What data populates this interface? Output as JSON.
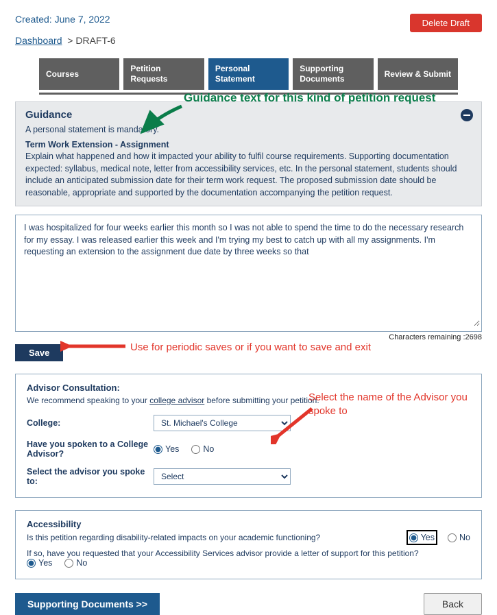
{
  "header": {
    "created_label": "Created: June 7, 2022",
    "delete_button": "Delete Draft"
  },
  "breadcrumb": {
    "link": "Dashboard",
    "current": "DRAFT-6"
  },
  "tabs": [
    {
      "label": "Courses"
    },
    {
      "label": "Petition Requests"
    },
    {
      "label": "Personal Statement",
      "active": true
    },
    {
      "label": "Supporting Documents"
    },
    {
      "label": "Review & Submit"
    }
  ],
  "guidance": {
    "title": "Guidance",
    "mandatory": "A personal statement is mandatory.",
    "subtype": "Term Work Extension - Assignment",
    "body": "Explain what happened and how it impacted your ability to fulfil course requirements. Supporting documentation expected: syllabus, medical note, letter from accessibility services, etc. In the personal statement, students should include an anticipated submission date for their term work request. The proposed submission date should be reasonable, appropriate and supported by the documentation accompanying the petition request."
  },
  "annotations": {
    "guidance_text": "Guidance text for this kind of petition request",
    "save_text": "Use for periodic saves or if you want to save and exit",
    "advisor_text": "Select the name of the Advisor you spoke to"
  },
  "statement": {
    "value": "I was hospitalized for four weeks earlier this month so I was not able to spend the time to do the necessary research for my essay. I was released earlier this week and I'm trying my best to catch up with all my assignments. I'm requesting an extension to the assignment due date by three weeks so that",
    "chars_remaining_label": "Characters remaining :2698"
  },
  "save_label": "Save",
  "advisor_panel": {
    "title": "Advisor Consultation:",
    "subtitle_pre": "We recommend speaking to your ",
    "subtitle_link": "college advisor",
    "subtitle_post": " before submitting your petition.",
    "college_label": "College:",
    "college_value": "St. Michael's College",
    "spoken_label": "Have you spoken to a College Advisor?",
    "yes": "Yes",
    "no": "No",
    "select_advisor_label": "Select the advisor you spoke to:",
    "advisor_value": "Select"
  },
  "accessibility_panel": {
    "title": "Accessibility",
    "q1": "Is this petition regarding disability-related impacts on your academic functioning?",
    "q2": "If so, have you requested that your Accessibility Services advisor provide a letter of support for this petition?",
    "yes": "Yes",
    "no": "No"
  },
  "bottom": {
    "next_label": "Supporting Documents >>",
    "back_label": "Back"
  }
}
